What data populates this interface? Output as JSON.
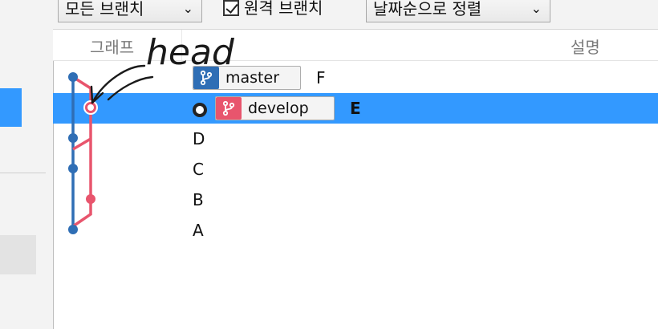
{
  "toolbar": {
    "branch_filter": "모든 브랜치",
    "remote_label": "원격 브랜치",
    "sort_option": "날짜순으로 정렬",
    "remote_checked": true
  },
  "header": {
    "graph": "그래프",
    "description": "설명"
  },
  "annotation": {
    "text": "head"
  },
  "commits": [
    {
      "message": "F",
      "branch": "master",
      "branch_color": "#2f6eb5"
    },
    {
      "message": "E",
      "branch": "develop",
      "branch_color": "#e8556d",
      "selected": true,
      "is_head": true
    },
    {
      "message": "D"
    },
    {
      "message": "C"
    },
    {
      "message": "B"
    },
    {
      "message": "A"
    }
  ],
  "colors": {
    "selection": "#3399ff",
    "master_lane": "#2f6eb5",
    "develop_lane": "#e8556d"
  },
  "icons": {
    "branch": "git-branch-icon",
    "dropdown": "chevron-down-icon",
    "checkbox": "checkmark-icon"
  }
}
